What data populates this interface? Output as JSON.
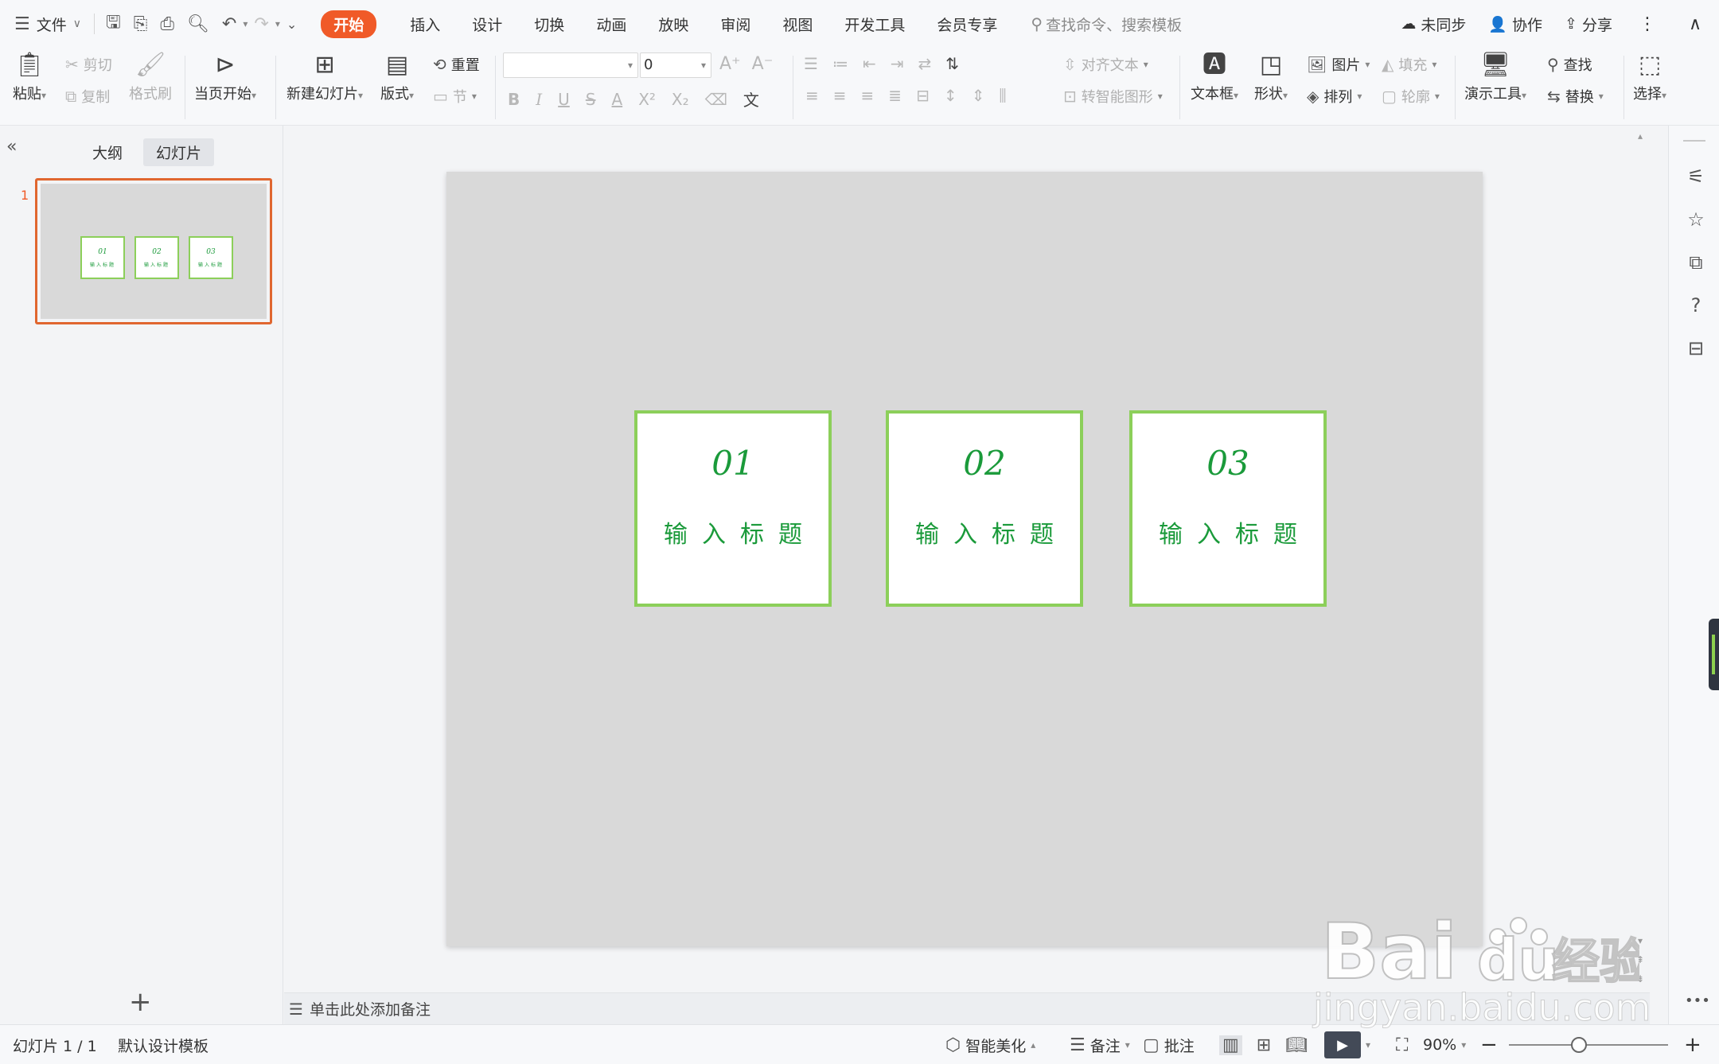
{
  "menubar": {
    "file_label": "文件",
    "tabs": [
      {
        "label": "开始",
        "active": true
      },
      {
        "label": "插入"
      },
      {
        "label": "设计"
      },
      {
        "label": "切换"
      },
      {
        "label": "动画"
      },
      {
        "label": "放映"
      },
      {
        "label": "审阅"
      },
      {
        "label": "视图"
      },
      {
        "label": "开发工具"
      },
      {
        "label": "会员专享"
      }
    ],
    "search_placeholder": "查找命令、搜索模板",
    "sync_label": "未同步",
    "collab_label": "协作",
    "share_label": "分享",
    "accent_color": "#f05a28"
  },
  "ribbon": {
    "paste": "粘贴",
    "cut": "剪切",
    "copy": "复制",
    "format_painter": "格式刷",
    "play_current": "当页开始",
    "new_slide": "新建幻灯片",
    "layout": "版式",
    "reset": "重置",
    "section": "节",
    "font_size": "0",
    "align_text": "对齐文本",
    "smart_shape": "转智能图形",
    "textbox": "文本框",
    "shape": "形状",
    "picture": "图片",
    "arrange": "排列",
    "fill": "填充",
    "outline": "轮廓",
    "present_tool": "演示工具",
    "find": "查找",
    "replace": "替换",
    "select": "选择"
  },
  "leftpanel": {
    "tab_outline": "大纲",
    "tab_slides": "幻灯片",
    "slide_number": "1"
  },
  "slide": {
    "background": "#d9d9d9",
    "card_border_color": "#8ccf5a",
    "text_color": "#1a9a3a",
    "cards": [
      {
        "num": "01",
        "title": "输入标题"
      },
      {
        "num": "02",
        "title": "输入标题"
      },
      {
        "num": "03",
        "title": "输入标题"
      }
    ]
  },
  "notes": {
    "placeholder": "单击此处添加备注"
  },
  "statusbar": {
    "slide_counter": "幻灯片 1 / 1",
    "template": "默认设计模板",
    "beautify": "智能美化",
    "notes": "备注",
    "comments": "批注",
    "zoom": "90%"
  },
  "watermark": {
    "brand": "Bai du 经验",
    "url": "jingyan.baidu.com"
  }
}
